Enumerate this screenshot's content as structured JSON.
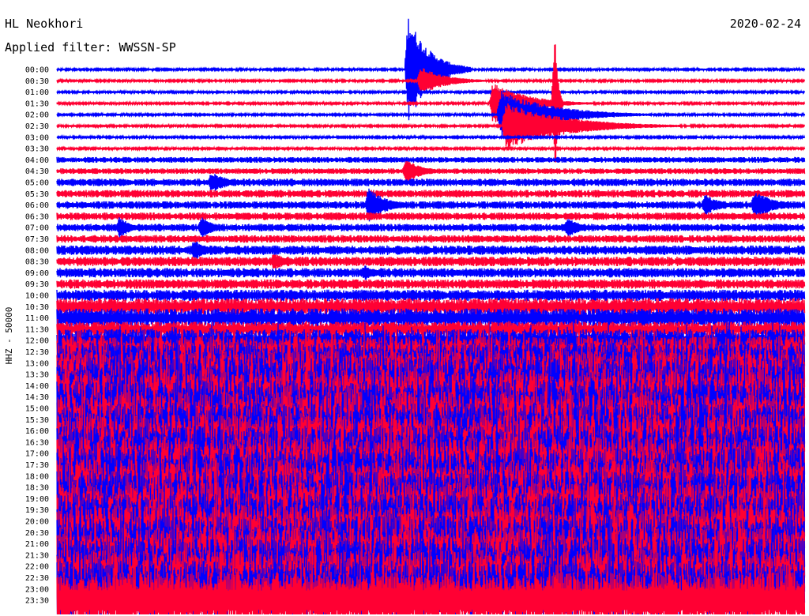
{
  "header": {
    "station": "HL Neokhori",
    "filter_label": "Applied filter: WWSSN-SP",
    "date": "2020-02-24"
  },
  "chart_data": {
    "type": "line",
    "title": "HL Neokhori",
    "subtitle": "Applied filter: WWSSN-SP",
    "date": "2020-02-24",
    "ylabel": "HHZ - 50000",
    "row_labels": [
      "00:00",
      "00:30",
      "01:00",
      "01:30",
      "02:00",
      "02:30",
      "03:00",
      "03:30",
      "04:00",
      "04:30",
      "05:00",
      "05:30",
      "06:00",
      "06:30",
      "07:00",
      "07:30",
      "08:00",
      "08:30",
      "09:00",
      "09:30",
      "10:00",
      "10:30",
      "11:00",
      "11:30",
      "12:00",
      "12:30",
      "13:00",
      "13:30",
      "14:00",
      "14:30",
      "15:00",
      "15:30",
      "16:00",
      "16:30",
      "17:00",
      "17:30",
      "18:00",
      "18:30",
      "19:00",
      "19:30",
      "20:00",
      "20:30",
      "21:00",
      "21:30",
      "22:00",
      "22:30",
      "23:00",
      "23:30"
    ],
    "row_minutes": 30,
    "series_colors": [
      "#0000ff",
      "#ff0033"
    ],
    "background_noise": [
      1,
      1,
      1,
      1,
      1,
      1,
      1,
      1,
      3,
      3,
      4,
      4,
      4,
      4,
      4,
      4,
      5,
      5,
      5,
      5,
      6,
      9,
      10,
      8,
      12,
      16,
      22,
      26,
      30,
      30,
      30,
      30,
      30,
      30,
      30,
      30,
      30,
      30,
      30,
      30,
      30,
      30,
      30,
      30,
      30,
      30,
      30,
      30
    ],
    "events": [
      {
        "row": 0,
        "minute": 14.1,
        "amplitude": 70,
        "duration_min": 2.5
      },
      {
        "row": 1,
        "minute": 14.6,
        "amplitude": 18,
        "duration_min": 3
      },
      {
        "row": 3,
        "minute": 17.5,
        "amplitude": 28,
        "duration_min": 4
      },
      {
        "row": 4,
        "minute": 17.8,
        "amplitude": 32,
        "duration_min": 6
      },
      {
        "row": 5,
        "minute": 18.0,
        "amplitude": 30,
        "duration_min": 7
      },
      {
        "row": 5,
        "minute": 20.5,
        "amplitude": 10,
        "duration_min": 6
      },
      {
        "row": 3,
        "minute": 20.0,
        "amplitude": 120,
        "duration_min": 0.3
      },
      {
        "row": 10,
        "minute": 6.2,
        "amplitude": 14,
        "duration_min": 2
      },
      {
        "row": 12,
        "minute": 12.5,
        "amplitude": 24,
        "duration_min": 2
      },
      {
        "row": 9,
        "minute": 14.0,
        "amplitude": 16,
        "duration_min": 2
      },
      {
        "row": 12,
        "minute": 26.0,
        "amplitude": 14,
        "duration_min": 2
      },
      {
        "row": 12,
        "minute": 28.0,
        "amplitude": 18,
        "duration_min": 2.5
      },
      {
        "row": 14,
        "minute": 2.5,
        "amplitude": 14,
        "duration_min": 1.5
      },
      {
        "row": 14,
        "minute": 5.8,
        "amplitude": 14,
        "duration_min": 1.5
      },
      {
        "row": 14,
        "minute": 20.5,
        "amplitude": 14,
        "duration_min": 1.5
      },
      {
        "row": 16,
        "minute": 5.5,
        "amplitude": 14,
        "duration_min": 1.5
      },
      {
        "row": 17,
        "minute": 8.7,
        "amplitude": 12,
        "duration_min": 1.5
      },
      {
        "row": 18,
        "minute": 12.3,
        "amplitude": 10,
        "duration_min": 2
      }
    ]
  }
}
